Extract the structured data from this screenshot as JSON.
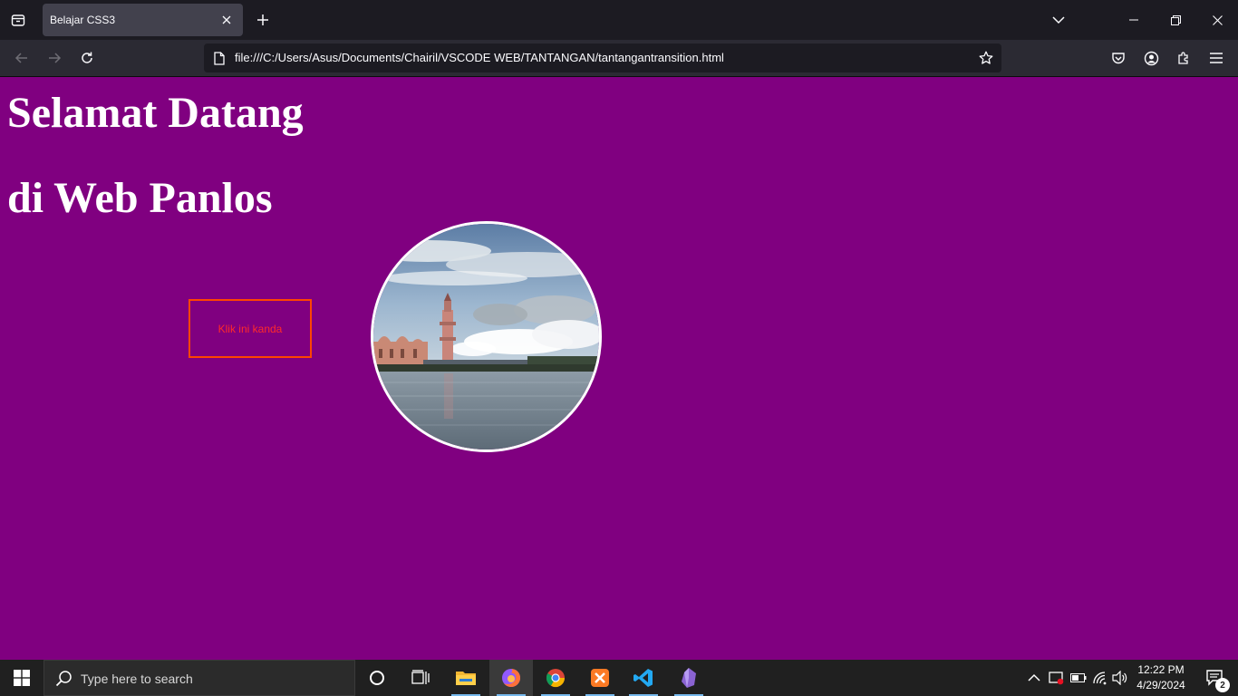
{
  "browser": {
    "tab_title": "Belajar CSS3",
    "url": "file:///C:/Users/Asus/Documents/Chairil/VSCODE WEB/TANTANGAN/tantangantransition.html",
    "icons": {
      "tab_list": "tab-list-icon",
      "close_tab": "close-icon",
      "new_tab": "plus-icon",
      "tabs_overflow": "chevron-down-icon",
      "minimize": "minimize-icon",
      "restore": "restore-icon",
      "close_window": "close-icon",
      "back": "back-arrow-icon",
      "forward": "forward-arrow-icon",
      "reload": "reload-icon",
      "page": "page-icon",
      "bookmark": "star-icon",
      "pocket": "pocket-icon",
      "account": "account-icon",
      "extensions": "extensions-icon",
      "menu": "hamburger-menu-icon"
    }
  },
  "page": {
    "background": "#800080",
    "heading_line1": "Selamat Datang",
    "heading_line2": "di Web Panlos",
    "button_label": "Klik ini kanda",
    "button_border_color": "#ff4500",
    "button_text_color": "#ff2a2a",
    "image_subject": "mosque-waterfront-photo"
  },
  "taskbar": {
    "search_placeholder": "Type here to search",
    "time": "12:22 PM",
    "date": "4/29/2024",
    "notification_count": "2",
    "apps": [
      "file-explorer-icon",
      "firefox-icon",
      "chrome-icon",
      "xampp-icon",
      "vscode-icon",
      "obsidian-icon"
    ]
  }
}
